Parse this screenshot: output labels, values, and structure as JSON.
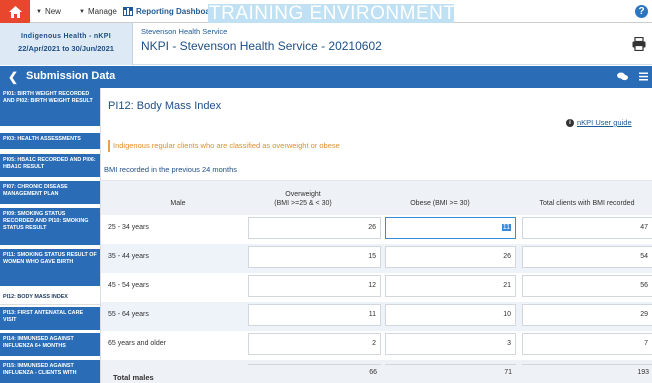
{
  "topbar": {
    "new_label": "New",
    "manage_label": "Manage",
    "report_label": "Reporting Dashboard",
    "training_banner": "TRAINING ENVIRONMENT",
    "help_label": "?"
  },
  "header": {
    "collection_name": "Indigenous Health - nKPI",
    "period": "22/Apr/2021 to 30/Jun/2021",
    "organisation": "Stevenson Health Service",
    "submission_title": "NKPI - Stevenson Health Service - 20210602"
  },
  "section": {
    "back_glyph": "❮",
    "title": "Submission Data"
  },
  "sidebar": {
    "items": [
      {
        "label": "PI01: Birth weight recorded and PI02: Birth weight result"
      },
      {
        "label": "PI03: Health assessments"
      },
      {
        "label": "PI05: HbA1c recorded and PI06: HbA1c result"
      },
      {
        "label": "PI07: Chronic disease management plan"
      },
      {
        "label": "PI09: Smoking status recorded and PI10: Smoking status result"
      },
      {
        "label": "PI11: Smoking status result of women who gave birth"
      },
      {
        "label": "PI12: Body mass index"
      },
      {
        "label": "PI13: First antenatal care visit"
      },
      {
        "label": "PI14: Immunised against influenza 6+ months"
      },
      {
        "label": "PI15: Immunised against influenza - clients with"
      }
    ]
  },
  "main": {
    "pi_title": "PI12: Body Mass Index",
    "guide_link": "nKPI User guide",
    "description": "Indigenous regular clients who are classified as overweight or obese",
    "bmi_note": "BMI recorded in the previous 24 months",
    "columns": {
      "group": "Male",
      "overweight_line1": "Overweight",
      "overweight_line2": "(BMI >=25 & < 30)",
      "obese": "Obese (BMI >= 30)",
      "total": "Total clients with BMI recorded"
    },
    "rows": [
      {
        "label": "25 - 34 years",
        "overweight": "26",
        "obese": "11",
        "total": "47"
      },
      {
        "label": "35 - 44 years",
        "overweight": "15",
        "obese": "26",
        "total": "54"
      },
      {
        "label": "45 - 54 years",
        "overweight": "12",
        "obese": "21",
        "total": "56"
      },
      {
        "label": "55 - 64 years",
        "overweight": "11",
        "obese": "10",
        "total": "29"
      },
      {
        "label": "65 years and older",
        "overweight": "2",
        "obese": "3",
        "total": "7"
      }
    ],
    "totals": {
      "label": "Total males",
      "overweight": "66",
      "obese": "71",
      "total": "193"
    }
  },
  "colors": {
    "primary_blue": "#2a6db6",
    "home_red": "#e8462d",
    "accent_orange": "#e0902a",
    "focus_blue": "#3b89d8"
  }
}
